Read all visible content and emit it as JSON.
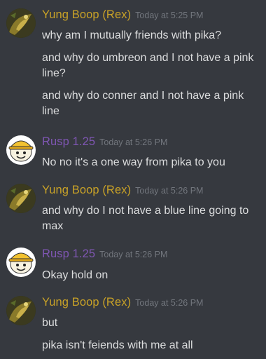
{
  "colors": {
    "background": "#36393f",
    "text": "#dcddde",
    "timestamp": "#72767d",
    "rex_name": "#c9a227",
    "rusp_name": "#7f56b3"
  },
  "messages": [
    {
      "author": "Yung Boop (Rex)",
      "timestamp": "Today at 5:25 PM",
      "avatar_icon": "pokemon-avatar-icon",
      "lines": [
        "why am I mutually friends with pika?",
        "and why do umbreon and I not have a pink line?",
        "and why do conner and I not have a pink line"
      ]
    },
    {
      "author": "Rusp 1.25",
      "timestamp": "Today at 5:26 PM",
      "avatar_icon": "yellow-hat-avatar-icon",
      "lines": [
        "No no it's a one way from pika to you"
      ]
    },
    {
      "author": "Yung Boop (Rex)",
      "timestamp": "Today at 5:26 PM",
      "avatar_icon": "pokemon-avatar-icon",
      "lines": [
        "and why do I not have a blue line going to max"
      ]
    },
    {
      "author": "Rusp 1.25",
      "timestamp": "Today at 5:26 PM",
      "avatar_icon": "yellow-hat-avatar-icon",
      "lines": [
        "Okay hold on"
      ]
    },
    {
      "author": "Yung Boop (Rex)",
      "timestamp": "Today at 5:26 PM",
      "avatar_icon": "pokemon-avatar-icon",
      "lines": [
        "but",
        "pika isn't feiends with me at all"
      ]
    }
  ]
}
